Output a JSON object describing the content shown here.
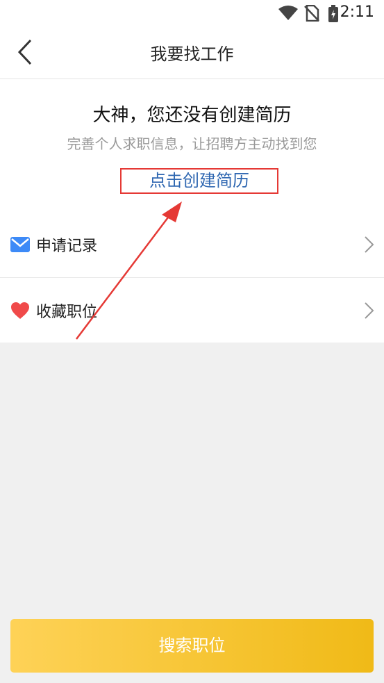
{
  "status_bar": {
    "time": "2:11",
    "icons": [
      "wifi-icon",
      "no-sim-icon",
      "battery-charging-icon"
    ]
  },
  "header": {
    "title": "我要找工作",
    "back_icon": "back-chevron-icon"
  },
  "empty_resume": {
    "title": "大神，您还没有创建简历",
    "subtitle": "完善个人求职信息，让招聘方主动找到您",
    "create_button_label": "点击创建简历"
  },
  "menu": {
    "items": [
      {
        "label": "申请记录",
        "icon": "envelope-icon"
      },
      {
        "label": "收藏职位",
        "icon": "heart-icon"
      }
    ]
  },
  "footer": {
    "search_button_label": "搜索职位"
  },
  "colors": {
    "accent_gradient_start": "#fed257",
    "accent_gradient_end": "#f0ba17",
    "link_blue": "#2f67b1",
    "annotation_red": "#e53935",
    "envelope_blue": "#3d8af7",
    "heart_red": "#f04a4a"
  }
}
